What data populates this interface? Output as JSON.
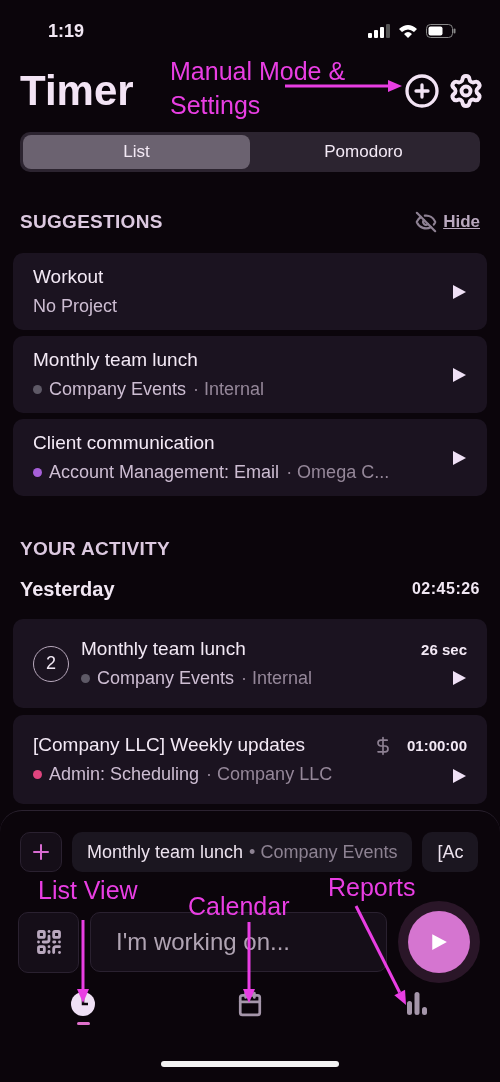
{
  "status_bar": {
    "time": "1:19"
  },
  "header": {
    "title": "Timer"
  },
  "segments": [
    {
      "label": "List",
      "selected": true
    },
    {
      "label": "Pomodoro",
      "selected": false
    }
  ],
  "suggestions": {
    "title": "SUGGESTIONS",
    "hide_label": "Hide",
    "items": [
      {
        "title": "Workout",
        "project": "No Project"
      },
      {
        "title": "Monthly team lunch",
        "project": "Company Events",
        "client": "· Internal",
        "color": "#5e5966"
      },
      {
        "title": "Client communication",
        "project": "Account Management: Email",
        "client": "· Omega C...",
        "color": "#a65fd8"
      }
    ]
  },
  "activity": {
    "title": "YOUR ACTIVITY",
    "days": [
      {
        "label": "Yesterday",
        "total": "02:45:26",
        "entries": [
          {
            "count": "2",
            "title": "Monthly team lunch",
            "project": "Company Events",
            "client": "· Internal",
            "color": "#5e5966",
            "duration": "26 sec",
            "billable": false
          },
          {
            "title": "[Company LLC] Weekly updates",
            "project": "Admin: Scheduling",
            "client": "· Company LLC",
            "color": "#e0457f",
            "duration": "01:00:00",
            "billable": true
          }
        ]
      }
    ]
  },
  "quick_chips": [
    {
      "title": "Monthly team lunch",
      "project": "• Company Events"
    },
    {
      "title": "[Ac"
    }
  ],
  "timer_input": {
    "placeholder": "I'm working on..."
  },
  "nav_tabs": [
    {
      "kind": "timer",
      "selected": true
    },
    {
      "kind": "calendar",
      "selected": false
    },
    {
      "kind": "reports",
      "selected": false
    }
  ],
  "annotations": [
    {
      "lines": [
        "Manual Mode &",
        "Settings"
      ]
    },
    {
      "lines": [
        "List View"
      ]
    },
    {
      "lines": [
        "Calendar"
      ]
    },
    {
      "lines": [
        "Reports"
      ]
    }
  ]
}
